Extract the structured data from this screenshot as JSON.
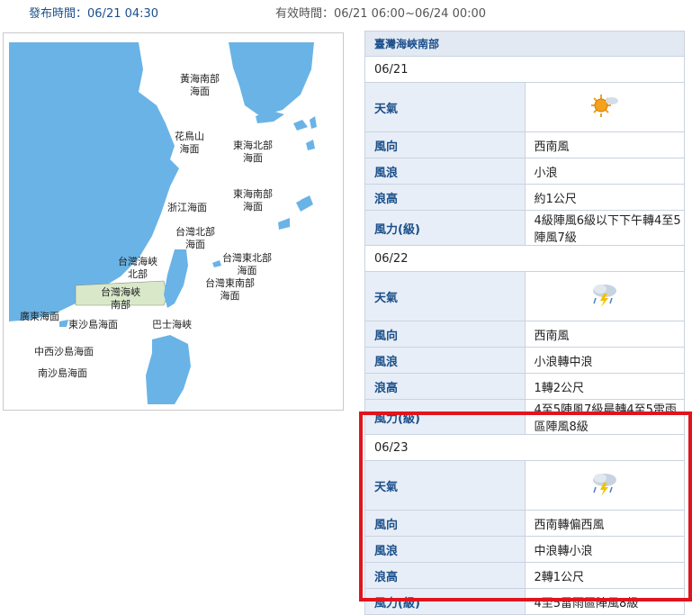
{
  "header": {
    "publish_label": "發布時間：",
    "publish_time": "06/21 04:30",
    "valid_label": "有效時間：",
    "valid_time": "06/21 06:00~06/24 00:00"
  },
  "map": {
    "zones": [
      {
        "id": "yellow-sea-south",
        "l1": "黃海南部",
        "l2": "海面"
      },
      {
        "id": "huaniaoshan",
        "l1": "花鳥山",
        "l2": "海面"
      },
      {
        "id": "east-sea-north",
        "l1": "東海北部",
        "l2": "海面"
      },
      {
        "id": "east-sea-south",
        "l1": "東海南部",
        "l2": "海面"
      },
      {
        "id": "zhejiang",
        "l1": "浙江海面",
        "l2": ""
      },
      {
        "id": "taiwan-north",
        "l1": "台灣北部",
        "l2": "海面"
      },
      {
        "id": "taiwan-ne",
        "l1": "台灣東北部",
        "l2": "海面"
      },
      {
        "id": "taiwan-strait-north",
        "l1": "台灣海峽",
        "l2": "北部"
      },
      {
        "id": "taiwan-se",
        "l1": "台灣東南部",
        "l2": "海面"
      },
      {
        "id": "taiwan-strait-south",
        "l1": "台灣海峽",
        "l2": "南部"
      },
      {
        "id": "guangdong",
        "l1": "廣東海面",
        "l2": ""
      },
      {
        "id": "dongsha",
        "l1": "東沙島海面",
        "l2": ""
      },
      {
        "id": "bashi",
        "l1": "巴士海峽",
        "l2": ""
      },
      {
        "id": "central-west-sha",
        "l1": "中西沙島海面",
        "l2": ""
      },
      {
        "id": "nansha",
        "l1": "南沙島海面",
        "l2": ""
      }
    ],
    "selected_zone": "taiwan-strait-south",
    "colors": {
      "sea": "#ffffff",
      "land": "#6ab3e6",
      "selected": "#d9e8c9"
    }
  },
  "forecast": {
    "region": "臺灣海峽南部",
    "labels": {
      "weather": "天氣",
      "wind_dir": "風向",
      "wave": "風浪",
      "wave_height": "浪高",
      "wind_force": "風力(級)"
    },
    "days": [
      {
        "date": "06/21",
        "weather_icon": "sunny-cloud-icon",
        "wind_dir": "西南風",
        "wave": "小浪",
        "wave_height": "約1公尺",
        "wind_force": "4級陣風6級以下下午轉4至5陣風7級"
      },
      {
        "date": "06/22",
        "weather_icon": "thunderstorm-icon",
        "wind_dir": "西南風",
        "wave": "小浪轉中浪",
        "wave_height": "1轉2公尺",
        "wind_force": "4至5陣風7級晨轉4至5雷雨區陣風8級"
      },
      {
        "date": "06/23",
        "weather_icon": "thunderstorm-icon",
        "wind_dir": "西南轉偏西風",
        "wave": "中浪轉小浪",
        "wave_height": "2轉1公尺",
        "wind_force": "4至5雷雨區陣風8級"
      }
    ]
  },
  "highlight_color": "#e0141e"
}
